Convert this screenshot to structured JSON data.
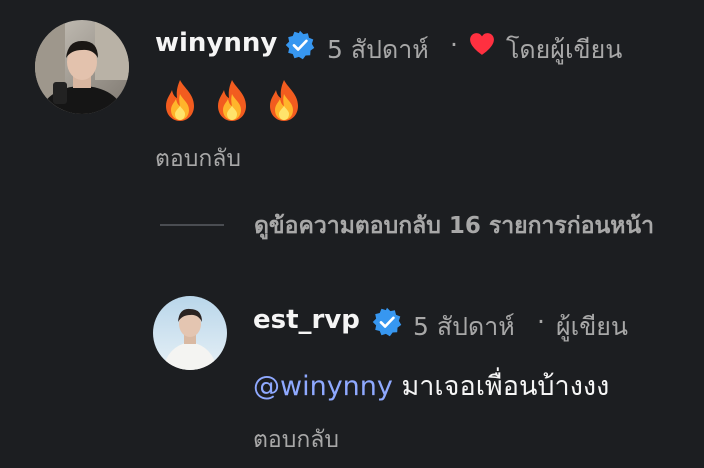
{
  "comments": [
    {
      "username": "winynny",
      "verified": true,
      "time": "5 สัปดาห์",
      "separator": "·",
      "liked_by": "โดยผู้เขียน",
      "text": "🔥🔥🔥",
      "icons": [
        "fire-icon",
        "fire-icon",
        "fire-icon"
      ],
      "reply_label": "ตอบกลับ"
    },
    {
      "username": "est_rvp",
      "verified": true,
      "time": "5 สัปดาห์",
      "separator": "·",
      "badge": "ผู้เขียน",
      "mention": "@winynny",
      "text": " มาเจอเพื่อนบ้างงง",
      "reply_label": "ตอบกลับ"
    }
  ],
  "view_replies": "ดูข้อความตอบกลับ 16 รายการก่อนหน้า",
  "colors": {
    "background": "#1c1e21",
    "verified": "#3797f0",
    "heart": "#ff3040",
    "mention": "#8fa9ff",
    "secondary_text": "#a8a8a8"
  }
}
